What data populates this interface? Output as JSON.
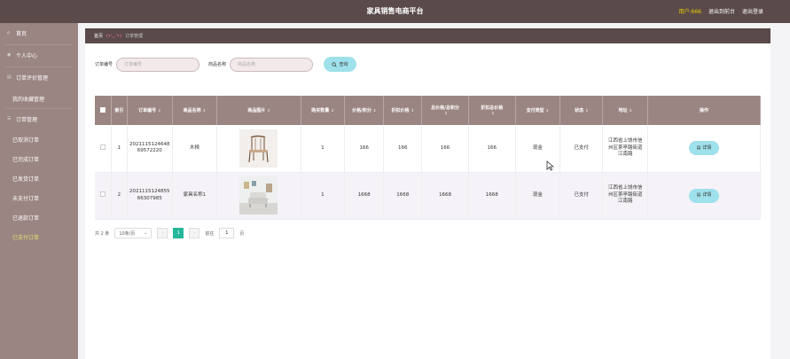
{
  "app": {
    "title": "家具销售电商平台",
    "user": "用户:666",
    "exit_admin": "退出到前台",
    "logout": "退出登录"
  },
  "sidebar": {
    "items": [
      {
        "label": "首页",
        "icon": "home-icon"
      },
      {
        "label": "个人中心",
        "icon": "user-icon"
      },
      {
        "label": "订单评价管理",
        "icon": "comment-icon"
      },
      {
        "label": "我的收藏管理",
        "sub": true
      },
      {
        "label": "订单管理",
        "icon": "list-icon"
      },
      {
        "label": "已取消订单",
        "sub": true
      },
      {
        "label": "已完成订单",
        "sub": true
      },
      {
        "label": "已发货订单",
        "sub": true
      },
      {
        "label": "未支付订单",
        "sub": true
      },
      {
        "label": "已退款订单",
        "sub": true
      },
      {
        "label": "已支付订单",
        "sub": true,
        "active": true
      }
    ]
  },
  "breadcrumb": {
    "home": "首页",
    "sep": "(•'◡'•)",
    "current": "订单管理"
  },
  "search": {
    "order_no_label": "订单编号",
    "order_no_placeholder": "订单编号",
    "goods_name_label": "商品名称",
    "goods_name_placeholder": "商品名称",
    "query_label": "查询"
  },
  "table": {
    "columns": [
      "",
      "索引",
      "订单编号",
      "商品名称",
      "商品图片",
      "购买数量",
      "价格/积分",
      "折扣价格",
      "总价格/总积分",
      "折扣总价格",
      "支付类型",
      "状态",
      "地址",
      "操作"
    ],
    "rows": [
      {
        "index": "1",
        "order_no": "202111512464869572220",
        "goods_name": "木椅",
        "quantity": "1",
        "price": "166",
        "discount_price": "166",
        "total_price": "166",
        "discount_total": "166",
        "pay_type": "现金",
        "status": "已支付",
        "address": "江西省上饶市信州区茶亭路街道江南路",
        "action": "详情"
      },
      {
        "index": "2",
        "order_no": "202111512485566307985",
        "goods_name": "家具名称1",
        "quantity": "1",
        "price": "1668",
        "discount_price": "1668",
        "total_price": "1668",
        "discount_total": "1668",
        "pay_type": "现金",
        "status": "已支付",
        "address": "江西省上饶市信州区茶亭路街道江南路",
        "action": "详情"
      }
    ]
  },
  "pager": {
    "total": "共 2 条",
    "page_size": "10条/页",
    "current_page": "1",
    "goto_label": "前往",
    "goto_value": "1",
    "page_unit": "页"
  }
}
